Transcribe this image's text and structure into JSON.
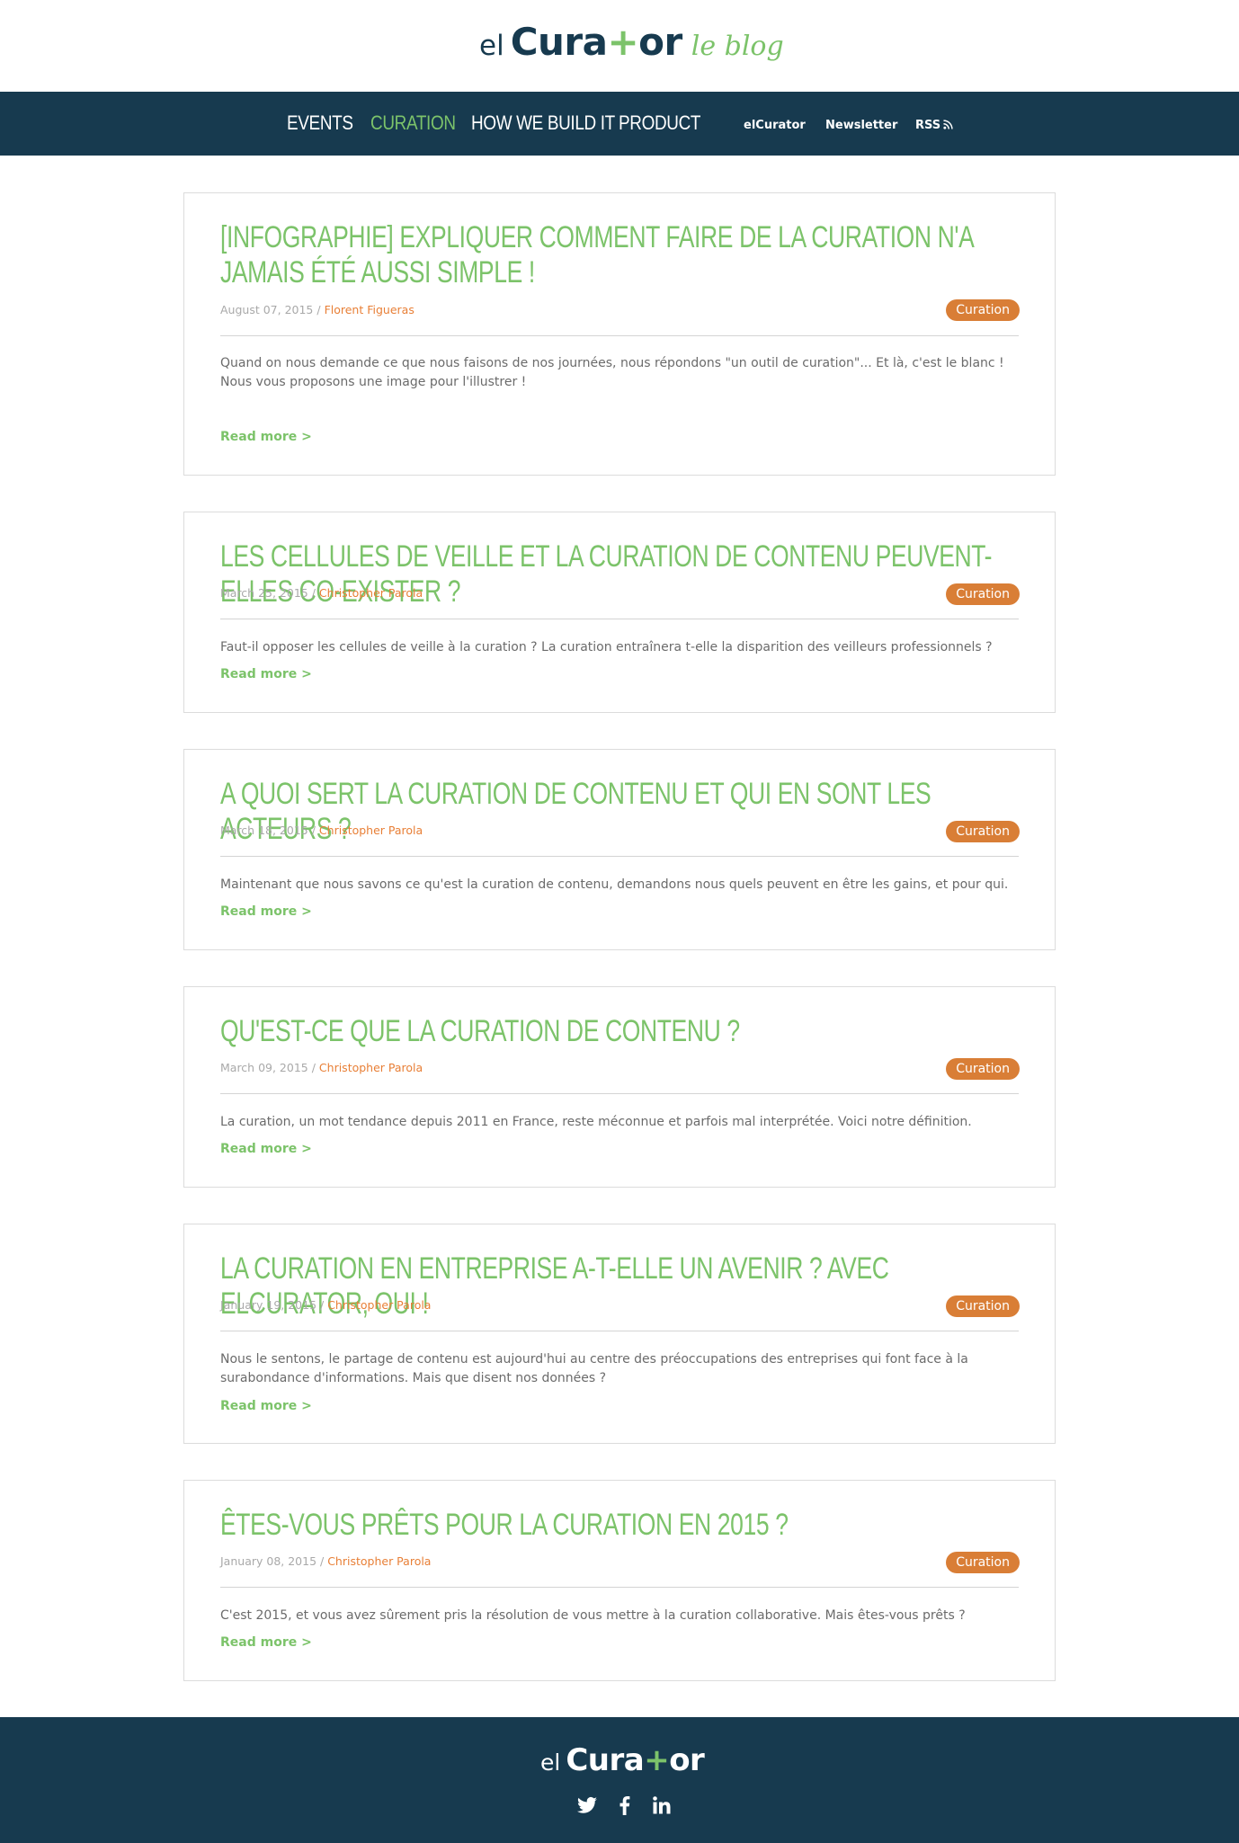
{
  "header": {
    "logo_prefix": "el",
    "logo_brand_start": "Cura",
    "logo_brand_plus": "+",
    "logo_brand_end": "or",
    "logo_tagline": "le blog"
  },
  "nav": {
    "main": [
      "EVENTS",
      "CURATION",
      "HOW WE BUILD IT",
      "PRODUCT"
    ],
    "active": "CURATION",
    "secondary": [
      "elCurator",
      "Newsletter",
      "RSS"
    ]
  },
  "posts": [
    {
      "title": "[INFOGRAPHIE] EXPLIQUER COMMENT FAIRE DE LA CURATION N'A JAMAIS ÉTÉ AUSSI SIMPLE !",
      "date": "August 07, 2015",
      "separator": " / ",
      "author": "Florent Figueras",
      "category": "Curation",
      "excerpt": "Quand on nous demande ce que nous faisons de nos journées, nous répondons \"un outil de curation\"... Et là, c'est le blanc ! Nous vous proposons une image pour l'illustrer !",
      "read_more": "Read more >"
    },
    {
      "title": "LES CELLULES DE VEILLE ET LA CURATION DE CONTENU PEUVENT-ELLES CO-EXISTER ?",
      "date": "March 25, 2015",
      "separator": " / ",
      "author": "Christopher Parola",
      "category": "Curation",
      "excerpt": "Faut-il opposer les cellules de veille à la curation ? La curation entraînera t-elle la disparition des veilleurs professionnels ?",
      "read_more": "Read more >"
    },
    {
      "title": "A QUOI SERT LA CURATION DE CONTENU ET QUI EN SONT LES ACTEURS ?",
      "date": "March 18, 2015",
      "separator": " / ",
      "author": "Christopher Parola",
      "category": "Curation",
      "excerpt": "Maintenant que nous savons ce qu'est la curation de contenu, demandons nous quels peuvent en être les gains, et pour qui.",
      "read_more": "Read more >"
    },
    {
      "title": "QU'EST-CE QUE LA CURATION DE CONTENU ?",
      "date": "March 09, 2015",
      "separator": " / ",
      "author": "Christopher Parola",
      "category": "Curation",
      "excerpt": "La curation, un mot tendance depuis 2011 en France, reste méconnue et parfois mal interprétée. Voici notre définition.",
      "read_more": "Read more >"
    },
    {
      "title": "LA CURATION EN ENTREPRISE A-T-ELLE UN AVENIR ? AVEC ELCURATOR, OUI !",
      "date": "January 19, 2015",
      "separator": " / ",
      "author": "Christopher Parola",
      "category": "Curation",
      "excerpt": "Nous le sentons, le partage de contenu est aujourd'hui au centre des préoccupations des entreprises qui font face à la surabondance d'informations. Mais que disent nos données ?",
      "read_more": "Read more >"
    },
    {
      "title": "ÊTES-VOUS PRÊTS POUR LA CURATION EN 2015 ?",
      "date": "January 08, 2015",
      "separator": " / ",
      "author": "Christopher Parola",
      "category": "Curation",
      "excerpt": "C'est 2015, et vous avez sûrement pris la résolution de vous mettre à la curation collaborative. Mais êtes-vous prêts ?",
      "read_more": "Read more >"
    }
  ],
  "footer": {
    "logo_prefix": "el",
    "logo_brand_start": "Cura",
    "logo_brand_plus": "+",
    "logo_brand_end": "or",
    "social_icons": [
      "twitter-icon",
      "facebook-icon",
      "linkedin-icon"
    ]
  },
  "colors": {
    "navy": "#173a4f",
    "green": "#7cc36a",
    "orange": "#e87f36",
    "badge": "#d97e36"
  }
}
